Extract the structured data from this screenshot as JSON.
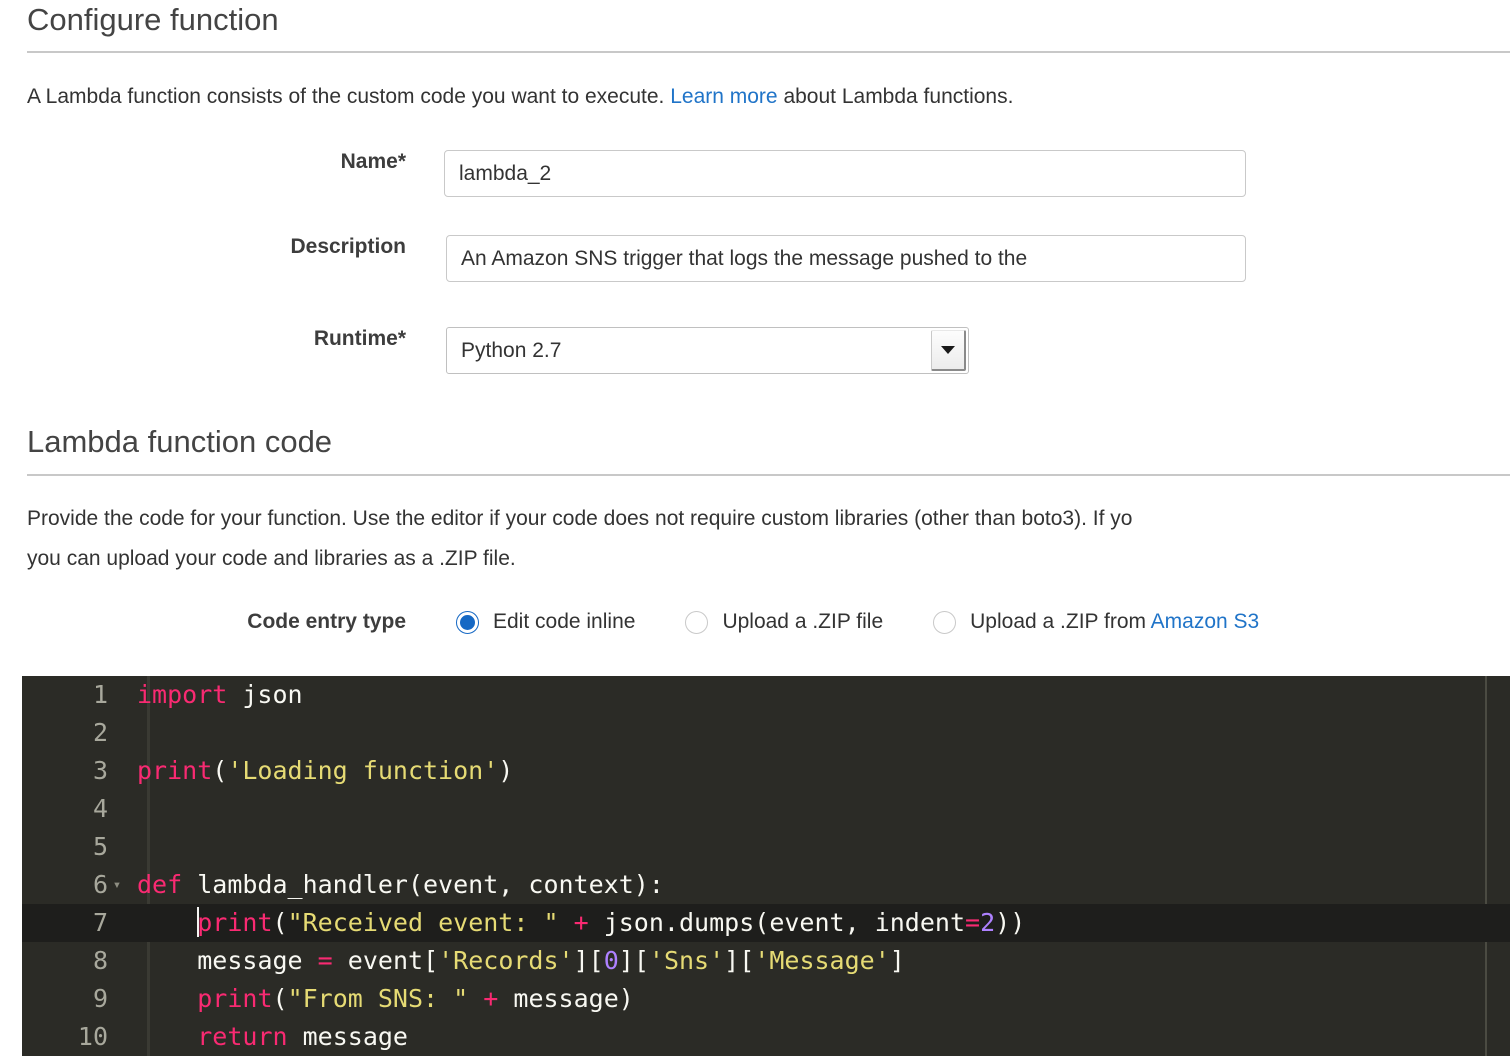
{
  "page": {
    "sections": [
      {
        "id": "configure-function",
        "title": "Configure function"
      },
      {
        "id": "lambda-function-code",
        "title": "Lambda function code"
      }
    ]
  },
  "configure": {
    "title": "Configure function",
    "intro_before_link": "A Lambda function consists of the custom code you want to execute. ",
    "intro_link": "Learn more",
    "intro_after_link": " about Lambda functions.",
    "fields": {
      "name": {
        "label": "Name*",
        "value": "lambda_2",
        "placeholder": ""
      },
      "description": {
        "label": "Description",
        "value": "An Amazon SNS trigger that logs the message pushed to the",
        "placeholder": ""
      },
      "runtime": {
        "label": "Runtime*",
        "value": "Python 2.7",
        "options": [
          "Python 2.7"
        ]
      }
    }
  },
  "code_section": {
    "title": "Lambda function code",
    "description_line1": "Provide the code for your function. Use the editor if your code does not require custom libraries (other than boto3). If yo",
    "description_line2": "you can upload your code and libraries as a .ZIP file.",
    "code_entry_type": {
      "label": "Code entry type",
      "selected": "Edit code inline",
      "options": [
        {
          "label": "Edit code inline",
          "selected": true,
          "link_text": ""
        },
        {
          "label": "Upload a .ZIP file",
          "selected": false,
          "link_text": ""
        },
        {
          "label": "Upload a .ZIP from ",
          "selected": false,
          "link_text": "Amazon S3"
        }
      ]
    }
  },
  "editor": {
    "active_line": 7,
    "cursor_line": 7,
    "cursor_column": 5,
    "language": "python",
    "lines": [
      {
        "num": "1",
        "fold": false,
        "text": "import json"
      },
      {
        "num": "2",
        "fold": false,
        "text": ""
      },
      {
        "num": "3",
        "fold": false,
        "text": "print('Loading function')"
      },
      {
        "num": "4",
        "fold": false,
        "text": ""
      },
      {
        "num": "5",
        "fold": false,
        "text": ""
      },
      {
        "num": "6",
        "fold": true,
        "text": "def lambda_handler(event, context):"
      },
      {
        "num": "7",
        "fold": false,
        "text": "    print(\"Received event: \" + json.dumps(event, indent=2))"
      },
      {
        "num": "8",
        "fold": false,
        "text": "    message = event['Records'][0]['Sns']['Message']"
      },
      {
        "num": "9",
        "fold": false,
        "text": "    print(\"From SNS: \" + message)"
      },
      {
        "num": "10",
        "fold": false,
        "text": "    return message"
      }
    ]
  },
  "colors": {
    "link": "#2074c8",
    "radio_selected": "#1568c4",
    "editor_bg": "#2b2b26",
    "editor_active_line": "#1e1e1c",
    "keyword": "#f92a72",
    "string": "#e6db74",
    "number": "#ae81ff",
    "plain_text": "#f8f8f2",
    "gutter_text": "#a8a89c",
    "rule": "#c8c8c8"
  }
}
